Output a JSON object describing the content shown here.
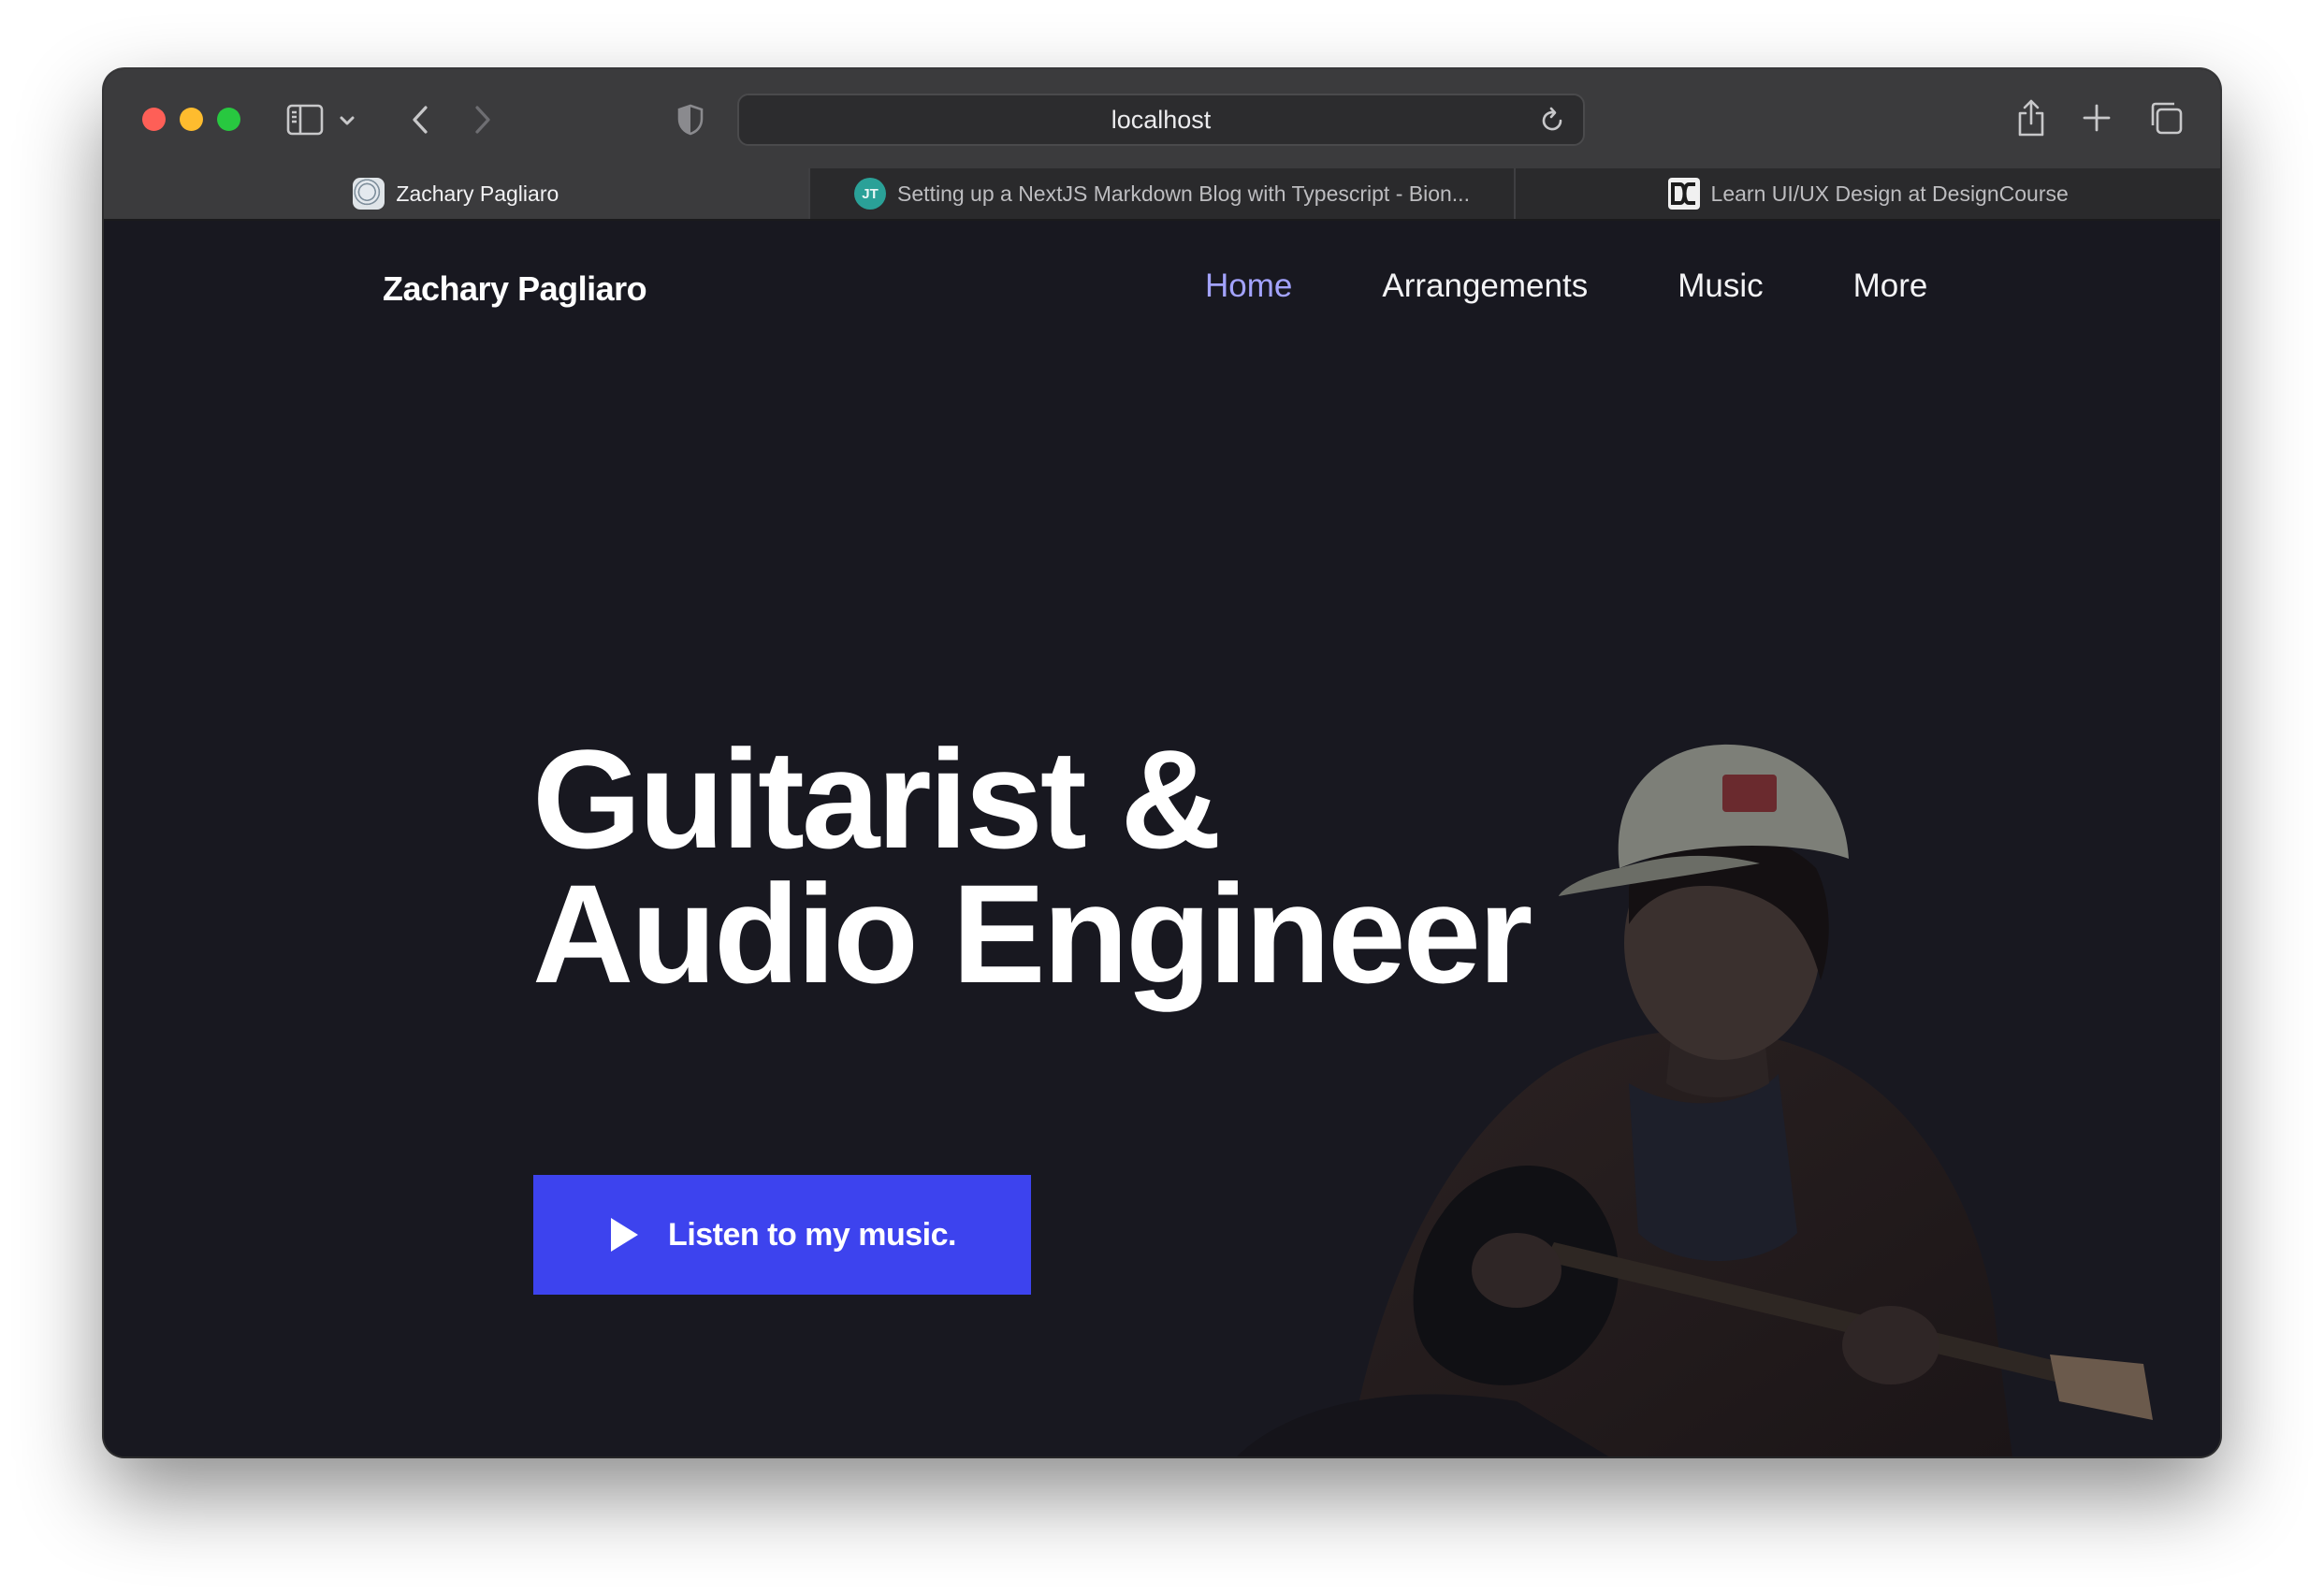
{
  "browser": {
    "url": "localhost",
    "tabs": [
      {
        "label": "Zachary Pagliaro",
        "favicon": "site-logo-icon",
        "active": true
      },
      {
        "label": "Setting up a NextJS Markdown Blog with Typescript - Bion...",
        "favicon": "jt-avatar-icon",
        "favicon_text": "JT",
        "active": false
      },
      {
        "label": "Learn UI/UX Design at DesignCourse",
        "favicon": "designcourse-logo-icon",
        "active": false
      }
    ]
  },
  "site": {
    "brand": "Zachary Pagliaro",
    "nav": [
      {
        "label": "Home",
        "active": true
      },
      {
        "label": "Arrangements",
        "active": false
      },
      {
        "label": "Music",
        "active": false
      },
      {
        "label": "More",
        "active": false
      }
    ],
    "hero": {
      "title_line1": "Guitarist &",
      "title_line2": "Audio Engineer",
      "cta_label": "Listen to my music.",
      "cta_icon": "play-icon"
    }
  },
  "colors": {
    "page_background": "#181820",
    "accent": "#3d43ee",
    "nav_active": "#a3a3ff",
    "text": "#ffffff"
  }
}
